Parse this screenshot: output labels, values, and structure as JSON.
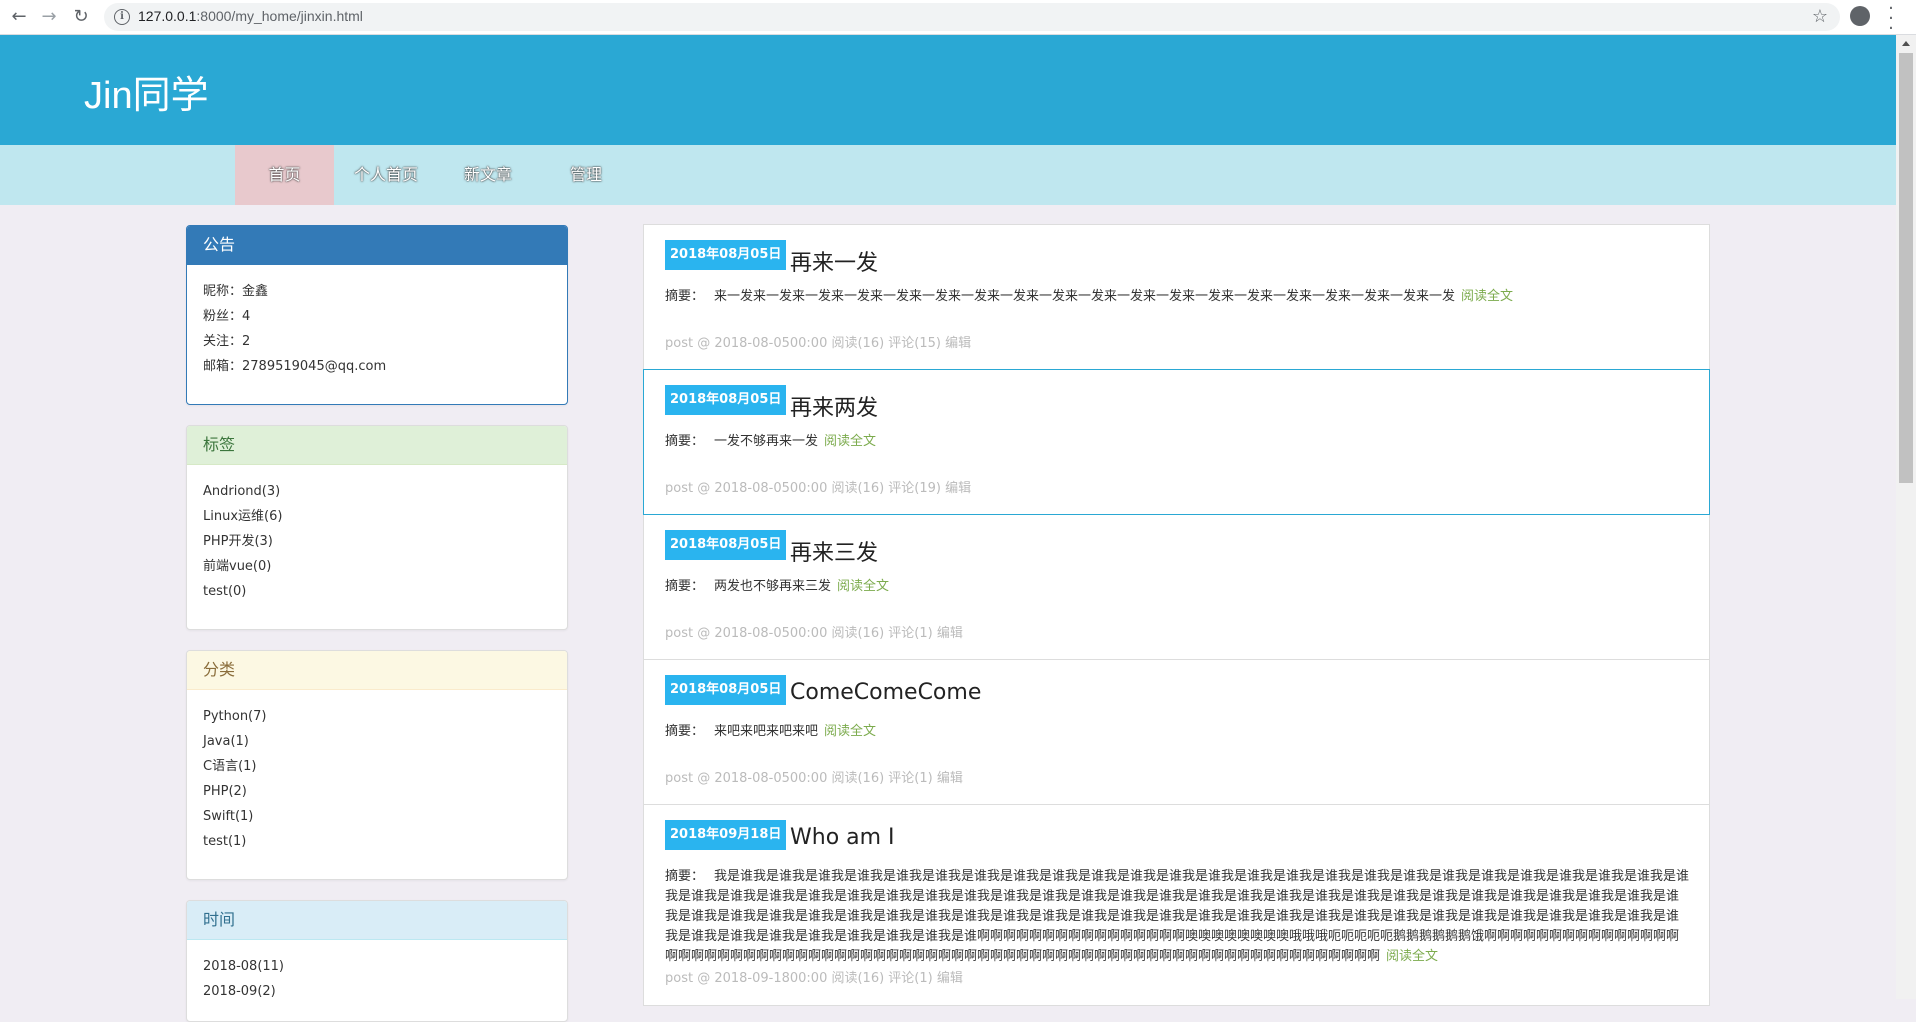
{
  "browser": {
    "url_host": "127.0.0.1",
    "url_rest": ":8000/my_home/jinxin.html"
  },
  "site": {
    "title": "Jin同学"
  },
  "nav": {
    "items": [
      "首页",
      "个人首页",
      "新文章",
      "管理"
    ]
  },
  "sidebar": {
    "announcement": {
      "heading": "公告",
      "lines": [
        "昵称：金鑫",
        "粉丝：4",
        "关注：2",
        "邮箱：2789519045@qq.com"
      ]
    },
    "tags": {
      "heading": "标签",
      "items": [
        "Andriond(3)",
        "Linux运维(6)",
        "PHP开发(3)",
        "前端vue(0)",
        "test(0)"
      ]
    },
    "categories": {
      "heading": "分类",
      "items": [
        "Python(7)",
        "Java(1)",
        "C语言(1)",
        "PHP(2)",
        "Swift(1)",
        "test(1)"
      ]
    },
    "archive": {
      "heading": "时间",
      "items": [
        "2018-08(11)",
        "2018-09(2)"
      ]
    }
  },
  "articles": [
    {
      "date": "2018年08月05日",
      "title": "再来一发",
      "summary_label": "摘要：",
      "summary": "来一发来一发来一发来一发来一发来一发来一发来一发来一发来一发来一发来一发来一发来一发来一发来一发来一发来一发来一发",
      "read_more": "阅读全文",
      "meta": "post @ 2018-08-0500:00 阅读(16) 评论(15) 编辑"
    },
    {
      "date": "2018年08月05日",
      "title": "再来两发",
      "summary_label": "摘要：",
      "summary": "一发不够再来一发",
      "read_more": "阅读全文",
      "meta": "post @ 2018-08-0500:00 阅读(16) 评论(19) 编辑"
    },
    {
      "date": "2018年08月05日",
      "title": "再来三发",
      "summary_label": "摘要：",
      "summary": "两发也不够再来三发",
      "read_more": "阅读全文",
      "meta": "post @ 2018-08-0500:00 阅读(16) 评论(1) 编辑"
    },
    {
      "date": "2018年08月05日",
      "title": "ComeComeCome",
      "summary_label": "摘要：",
      "summary": "来吧来吧来吧来吧",
      "read_more": "阅读全文",
      "meta": "post @ 2018-08-0500:00 阅读(16) 评论(1) 编辑"
    },
    {
      "date": "2018年09月18日",
      "title": "Who am I",
      "summary_label": "摘要：",
      "summary": "我是谁我是谁我是谁我是谁我是谁我是谁我是谁我是谁我是谁我是谁我是谁我是谁我是谁我是谁我是谁我是谁我是谁我是谁我是谁我是谁我是谁我是谁我是谁我是谁我是谁我是谁我是谁我是谁我是谁我是谁我是谁我是谁我是谁我是谁我是谁我是谁我是谁我是谁我是谁我是谁我是谁我是谁我是谁我是谁我是谁我是谁我是谁我是谁我是谁我是谁我是谁我是谁我是谁我是谁我是谁我是谁我是谁我是谁我是谁我是谁我是谁我是谁我是谁我是谁我是谁我是谁我是谁我是谁我是谁我是谁我是谁我是谁我是谁我是谁我是谁我是谁我是谁我是谁我是谁我是谁我是谁我是谁我是谁我是谁我是谁啊啊啊啊啊啊啊啊啊啊啊啊啊啊啊啊噢噢噢噢噢噢噢噢哦哦哦呃呃呃呃呃鹅鹅鹅鹅鹅鹅饿啊啊啊啊啊啊啊啊啊啊啊啊啊啊啊啊啊啊啊啊啊啊啊啊啊啊啊啊啊啊啊啊啊啊啊啊啊啊啊啊啊啊啊啊啊啊啊啊啊啊啊啊啊啊啊啊啊啊啊啊啊啊啊啊啊啊啊啊啊啊",
      "read_more": "阅读全文",
      "meta": "post @ 2018-09-1800:00 阅读(16) 评论(1) 编辑"
    }
  ]
}
